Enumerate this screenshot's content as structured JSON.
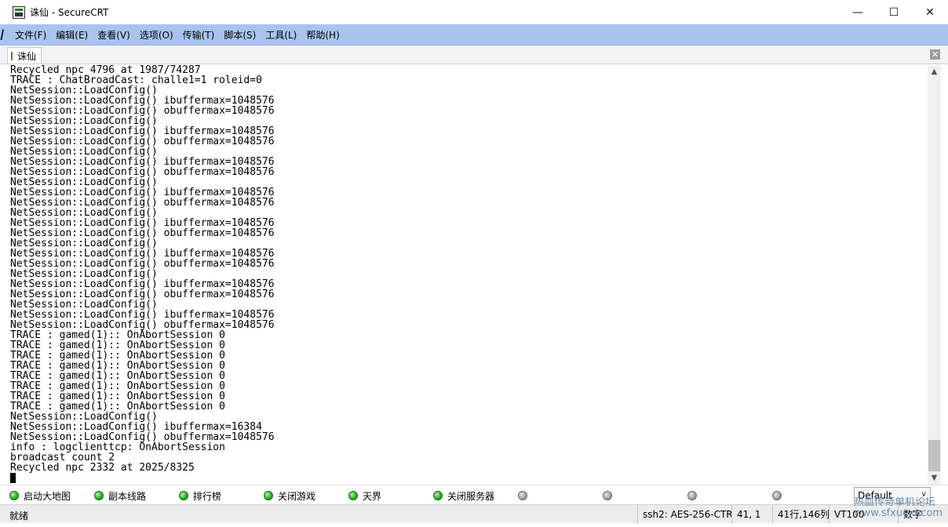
{
  "window": {
    "title": "诛仙 - SecureCRT",
    "minimize": "—",
    "maximize": "☐",
    "close": "✕"
  },
  "left_edge_glyph": "l",
  "menu": [
    "文件(F)",
    "编辑(E)",
    "查看(V)",
    "选项(O)",
    "传输(T)",
    "脚本(S)",
    "工具(L)",
    "帮助(H)"
  ],
  "tabs": [
    {
      "label": "诛仙"
    }
  ],
  "tab_close": "✕",
  "terminal": {
    "lines": [
      "Recycled npc 4796 at 1987/74287",
      "TRACE : ChatBroadCast: challe1=1 roleid=0",
      "NetSession::LoadConfig()",
      "NetSession::LoadConfig() ibuffermax=1048576",
      "NetSession::LoadConfig() obuffermax=1048576",
      "NetSession::LoadConfig()",
      "NetSession::LoadConfig() ibuffermax=1048576",
      "NetSession::LoadConfig() obuffermax=1048576",
      "NetSession::LoadConfig()",
      "NetSession::LoadConfig() ibuffermax=1048576",
      "NetSession::LoadConfig() obuffermax=1048576",
      "NetSession::LoadConfig()",
      "NetSession::LoadConfig() ibuffermax=1048576",
      "NetSession::LoadConfig() obuffermax=1048576",
      "NetSession::LoadConfig()",
      "NetSession::LoadConfig() ibuffermax=1048576",
      "NetSession::LoadConfig() obuffermax=1048576",
      "NetSession::LoadConfig()",
      "NetSession::LoadConfig() ibuffermax=1048576",
      "NetSession::LoadConfig() obuffermax=1048576",
      "NetSession::LoadConfig()",
      "NetSession::LoadConfig() ibuffermax=1048576",
      "NetSession::LoadConfig() obuffermax=1048576",
      "NetSession::LoadConfig()",
      "NetSession::LoadConfig() ibuffermax=1048576",
      "NetSession::LoadConfig() obuffermax=1048576",
      "TRACE : gamed(1):: OnAbortSession 0",
      "TRACE : gamed(1):: OnAbortSession 0",
      "TRACE : gamed(1):: OnAbortSession 0",
      "TRACE : gamed(1):: OnAbortSession 0",
      "TRACE : gamed(1):: OnAbortSession 0",
      "TRACE : gamed(1):: OnAbortSession 0",
      "TRACE : gamed(1):: OnAbortSession 0",
      "TRACE : gamed(1):: OnAbortSession 0",
      "NetSession::LoadConfig()",
      "NetSession::LoadConfig() ibuffermax=16384",
      "NetSession::LoadConfig() obuffermax=1048576",
      "info : logclienttcp: OnAbortSession",
      "broadcast count 2",
      "Recycled npc 2332 at 2025/8325"
    ]
  },
  "scrollbar": {
    "up": "▲",
    "down": "▼"
  },
  "button_bar": {
    "buttons": [
      {
        "label": "启动大地图",
        "state": "green"
      },
      {
        "label": "副本线路",
        "state": "green"
      },
      {
        "label": "排行榜",
        "state": "green"
      },
      {
        "label": "关闭游戏",
        "state": "green"
      },
      {
        "label": "天界",
        "state": "green"
      },
      {
        "label": "关闭服务器",
        "state": "green"
      },
      {
        "label": "",
        "state": "gray"
      },
      {
        "label": "",
        "state": "gray"
      },
      {
        "label": "",
        "state": "gray"
      },
      {
        "label": "",
        "state": "gray"
      }
    ],
    "session_select": "Default",
    "select_arrow": "∨"
  },
  "status_bar": {
    "ready": "就绪",
    "encryption": "ssh2: AES-256-CTR",
    "cursor_pos": "41,  1",
    "size": "41行,146列",
    "term_type": "VT100",
    "caps": "数字"
  },
  "watermark": [
    "热血传奇单机论坛",
    "www.sfxuexi.com"
  ],
  "colors": {
    "menubar": "#a9c3ef",
    "led_on": "#27b427",
    "led_off": "#a0a0a0"
  }
}
